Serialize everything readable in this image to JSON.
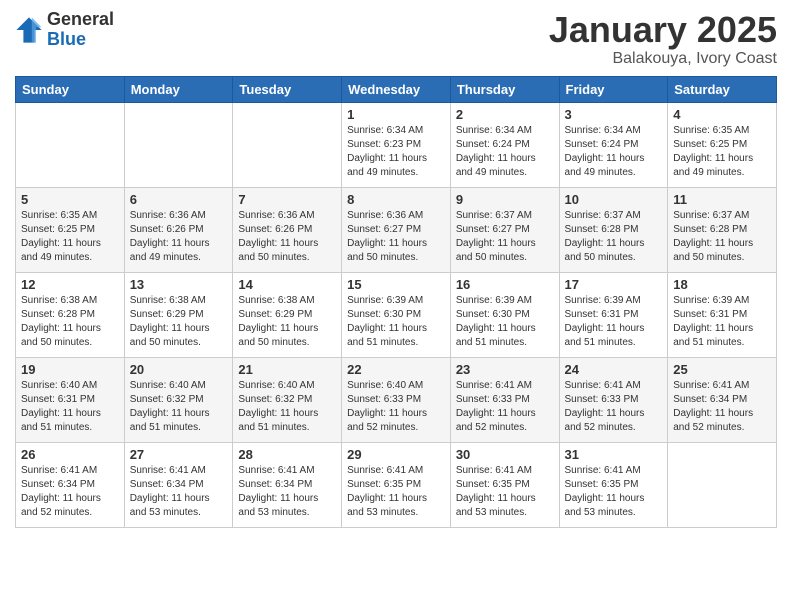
{
  "logo": {
    "general": "General",
    "blue": "Blue"
  },
  "title": "January 2025",
  "subtitle": "Balakouya, Ivory Coast",
  "days_header": [
    "Sunday",
    "Monday",
    "Tuesday",
    "Wednesday",
    "Thursday",
    "Friday",
    "Saturday"
  ],
  "weeks": [
    [
      {
        "day": "",
        "info": ""
      },
      {
        "day": "",
        "info": ""
      },
      {
        "day": "",
        "info": ""
      },
      {
        "day": "1",
        "info": "Sunrise: 6:34 AM\nSunset: 6:23 PM\nDaylight: 11 hours\nand 49 minutes."
      },
      {
        "day": "2",
        "info": "Sunrise: 6:34 AM\nSunset: 6:24 PM\nDaylight: 11 hours\nand 49 minutes."
      },
      {
        "day": "3",
        "info": "Sunrise: 6:34 AM\nSunset: 6:24 PM\nDaylight: 11 hours\nand 49 minutes."
      },
      {
        "day": "4",
        "info": "Sunrise: 6:35 AM\nSunset: 6:25 PM\nDaylight: 11 hours\nand 49 minutes."
      }
    ],
    [
      {
        "day": "5",
        "info": "Sunrise: 6:35 AM\nSunset: 6:25 PM\nDaylight: 11 hours\nand 49 minutes."
      },
      {
        "day": "6",
        "info": "Sunrise: 6:36 AM\nSunset: 6:26 PM\nDaylight: 11 hours\nand 49 minutes."
      },
      {
        "day": "7",
        "info": "Sunrise: 6:36 AM\nSunset: 6:26 PM\nDaylight: 11 hours\nand 50 minutes."
      },
      {
        "day": "8",
        "info": "Sunrise: 6:36 AM\nSunset: 6:27 PM\nDaylight: 11 hours\nand 50 minutes."
      },
      {
        "day": "9",
        "info": "Sunrise: 6:37 AM\nSunset: 6:27 PM\nDaylight: 11 hours\nand 50 minutes."
      },
      {
        "day": "10",
        "info": "Sunrise: 6:37 AM\nSunset: 6:28 PM\nDaylight: 11 hours\nand 50 minutes."
      },
      {
        "day": "11",
        "info": "Sunrise: 6:37 AM\nSunset: 6:28 PM\nDaylight: 11 hours\nand 50 minutes."
      }
    ],
    [
      {
        "day": "12",
        "info": "Sunrise: 6:38 AM\nSunset: 6:28 PM\nDaylight: 11 hours\nand 50 minutes."
      },
      {
        "day": "13",
        "info": "Sunrise: 6:38 AM\nSunset: 6:29 PM\nDaylight: 11 hours\nand 50 minutes."
      },
      {
        "day": "14",
        "info": "Sunrise: 6:38 AM\nSunset: 6:29 PM\nDaylight: 11 hours\nand 50 minutes."
      },
      {
        "day": "15",
        "info": "Sunrise: 6:39 AM\nSunset: 6:30 PM\nDaylight: 11 hours\nand 51 minutes."
      },
      {
        "day": "16",
        "info": "Sunrise: 6:39 AM\nSunset: 6:30 PM\nDaylight: 11 hours\nand 51 minutes."
      },
      {
        "day": "17",
        "info": "Sunrise: 6:39 AM\nSunset: 6:31 PM\nDaylight: 11 hours\nand 51 minutes."
      },
      {
        "day": "18",
        "info": "Sunrise: 6:39 AM\nSunset: 6:31 PM\nDaylight: 11 hours\nand 51 minutes."
      }
    ],
    [
      {
        "day": "19",
        "info": "Sunrise: 6:40 AM\nSunset: 6:31 PM\nDaylight: 11 hours\nand 51 minutes."
      },
      {
        "day": "20",
        "info": "Sunrise: 6:40 AM\nSunset: 6:32 PM\nDaylight: 11 hours\nand 51 minutes."
      },
      {
        "day": "21",
        "info": "Sunrise: 6:40 AM\nSunset: 6:32 PM\nDaylight: 11 hours\nand 51 minutes."
      },
      {
        "day": "22",
        "info": "Sunrise: 6:40 AM\nSunset: 6:33 PM\nDaylight: 11 hours\nand 52 minutes."
      },
      {
        "day": "23",
        "info": "Sunrise: 6:41 AM\nSunset: 6:33 PM\nDaylight: 11 hours\nand 52 minutes."
      },
      {
        "day": "24",
        "info": "Sunrise: 6:41 AM\nSunset: 6:33 PM\nDaylight: 11 hours\nand 52 minutes."
      },
      {
        "day": "25",
        "info": "Sunrise: 6:41 AM\nSunset: 6:34 PM\nDaylight: 11 hours\nand 52 minutes."
      }
    ],
    [
      {
        "day": "26",
        "info": "Sunrise: 6:41 AM\nSunset: 6:34 PM\nDaylight: 11 hours\nand 52 minutes."
      },
      {
        "day": "27",
        "info": "Sunrise: 6:41 AM\nSunset: 6:34 PM\nDaylight: 11 hours\nand 53 minutes."
      },
      {
        "day": "28",
        "info": "Sunrise: 6:41 AM\nSunset: 6:34 PM\nDaylight: 11 hours\nand 53 minutes."
      },
      {
        "day": "29",
        "info": "Sunrise: 6:41 AM\nSunset: 6:35 PM\nDaylight: 11 hours\nand 53 minutes."
      },
      {
        "day": "30",
        "info": "Sunrise: 6:41 AM\nSunset: 6:35 PM\nDaylight: 11 hours\nand 53 minutes."
      },
      {
        "day": "31",
        "info": "Sunrise: 6:41 AM\nSunset: 6:35 PM\nDaylight: 11 hours\nand 53 minutes."
      },
      {
        "day": "",
        "info": ""
      }
    ]
  ]
}
